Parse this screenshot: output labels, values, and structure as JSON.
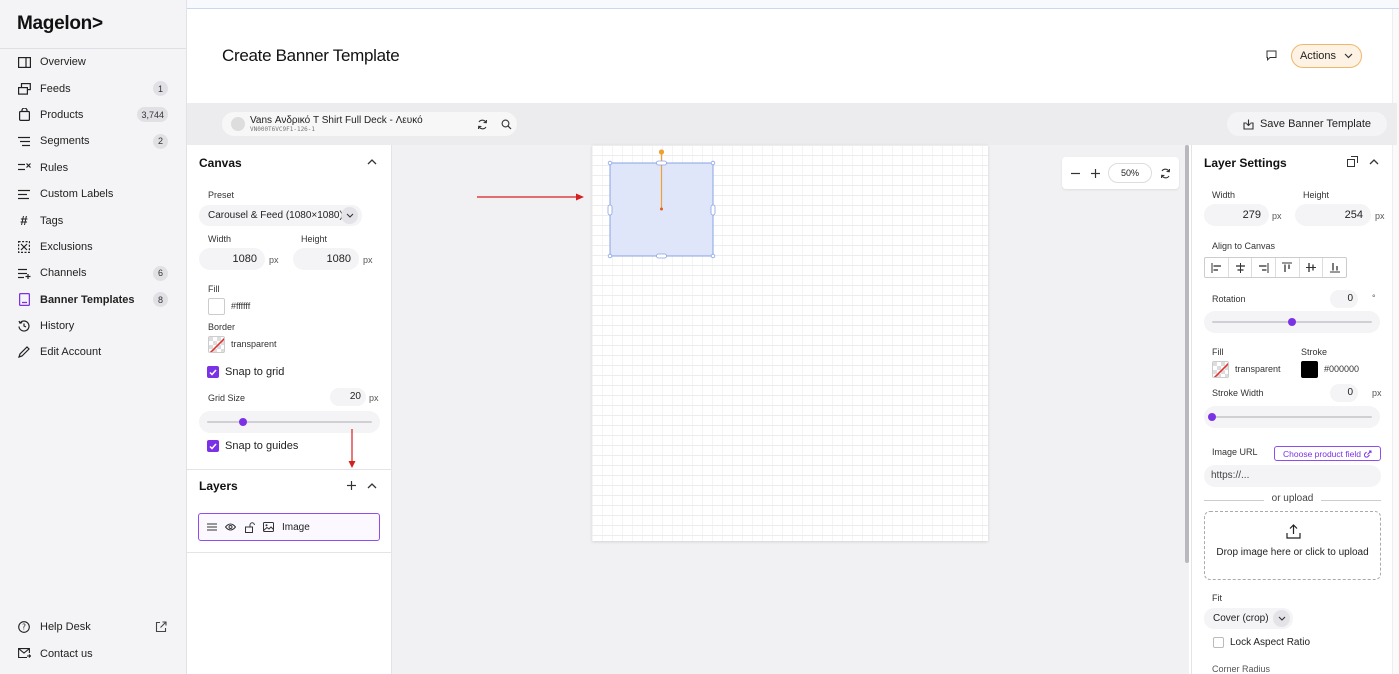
{
  "app": {
    "logo": "Magelon>"
  },
  "nav": {
    "items": [
      {
        "label": "Overview",
        "icon": "overview-icon"
      },
      {
        "label": "Feeds",
        "icon": "feeds-icon",
        "badge": "1"
      },
      {
        "label": "Products",
        "icon": "products-icon",
        "badge": "3,744"
      },
      {
        "label": "Segments",
        "icon": "segments-icon",
        "badge": "2"
      },
      {
        "label": "Rules",
        "icon": "rules-icon"
      },
      {
        "label": "Custom Labels",
        "icon": "custom-labels-icon"
      },
      {
        "label": "Tags",
        "icon": "hash-icon"
      },
      {
        "label": "Exclusions",
        "icon": "exclusions-icon"
      },
      {
        "label": "Channels",
        "icon": "channels-icon",
        "badge": "6"
      },
      {
        "label": "Banner Templates",
        "icon": "banner-icon",
        "badge": "8",
        "active": true
      },
      {
        "label": "History",
        "icon": "history-icon"
      },
      {
        "label": "Edit Account",
        "icon": "pencil-icon"
      }
    ],
    "bottom": [
      {
        "label": "Help Desk",
        "icon": "help-icon"
      },
      {
        "label": "Contact us",
        "icon": "mail-icon"
      }
    ]
  },
  "header": {
    "title": "Create Banner Template",
    "actions_label": "Actions"
  },
  "product": {
    "name": "Vans Ανδρικό T Shirt Full Deck - Λευκό",
    "sku": "VN000T6VC9F1-126-1"
  },
  "toolbar": {
    "save_label": "Save Banner Template"
  },
  "canvas_panel": {
    "title": "Canvas",
    "preset_label": "Preset",
    "preset_value": "Carousel & Feed (1080×1080)",
    "width_label": "Width",
    "width_value": "1080",
    "height_label": "Height",
    "height_value": "1080",
    "unit": "px",
    "fill_label": "Fill",
    "fill_value": "#ffffff",
    "border_label": "Border",
    "border_value": "transparent",
    "snap_grid_label": "Snap to grid",
    "grid_size_label": "Grid Size",
    "grid_size_value": "20",
    "grid_size_fraction": 0.22,
    "snap_guides_label": "Snap to guides"
  },
  "layers_panel": {
    "title": "Layers",
    "layers": [
      {
        "label": "Image"
      }
    ]
  },
  "zoom": {
    "value": "50%"
  },
  "layer_settings": {
    "title": "Layer Settings",
    "width_label": "Width",
    "width_value": "279",
    "height_label": "Height",
    "height_value": "254",
    "unit": "px",
    "align_label": "Align to Canvas",
    "rotation_label": "Rotation",
    "rotation_value": "0",
    "rotation_unit": "°",
    "rotation_fraction": 0.5,
    "fill_label": "Fill",
    "fill_value": "transparent",
    "stroke_label": "Stroke",
    "stroke_value": "#000000",
    "stroke_width_label": "Stroke Width",
    "stroke_width_value": "0",
    "stroke_width_fraction": 0.0,
    "image_url_label": "Image URL",
    "choose_field_label": "Choose product field",
    "url_placeholder": "https://...",
    "or_upload": "or upload",
    "drop_text": "Drop image here or click to upload",
    "fit_label": "Fit",
    "fit_value": "Cover (crop)",
    "lock_aspect_label": "Lock Aspect Ratio",
    "corner_radius_label": "Corner Radius"
  },
  "colors": {
    "accent": "#7b32e6",
    "actions_border": "#f0b76a",
    "actions_bg": "#fdf2e3",
    "selection": "#dfe6fa",
    "arrow": "#d42020",
    "handle": "#f0a030"
  }
}
